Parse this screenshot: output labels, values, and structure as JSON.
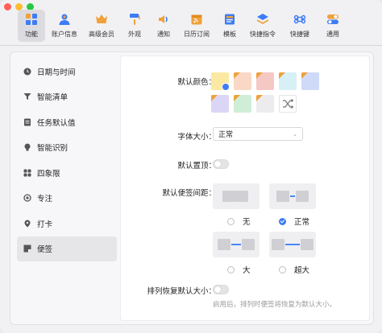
{
  "toolbar": {
    "items": [
      {
        "label": "功能",
        "icon": "functions-grid-icon",
        "color": "#3d7cf5",
        "active": true
      },
      {
        "label": "账户信息",
        "icon": "user-icon",
        "color": "#3d7cf5"
      },
      {
        "label": "高级会员",
        "icon": "crown-icon",
        "color": "#f0a13a"
      },
      {
        "label": "外观",
        "icon": "paint-roller-icon",
        "color": "#f0a13a"
      },
      {
        "label": "通知",
        "icon": "speaker-icon",
        "color": "#f0a13a"
      },
      {
        "label": "日历订阅",
        "icon": "calendar-feed-icon",
        "color": "#f0a13a"
      },
      {
        "label": "模板",
        "icon": "template-icon",
        "color": "#3d7cf5"
      },
      {
        "label": "快捷指令",
        "icon": "layers-icon",
        "color": "#3d7cf5"
      },
      {
        "label": "快捷键",
        "icon": "command-icon",
        "color": "#3d7cf5"
      },
      {
        "label": "通用",
        "icon": "toggle-icon",
        "color": "#3d7cf5"
      }
    ]
  },
  "sidebar": {
    "items": [
      {
        "label": "日期与时间",
        "icon": "clock-icon"
      },
      {
        "label": "智能清单",
        "icon": "filter-icon"
      },
      {
        "label": "任务默认值",
        "icon": "list-icon"
      },
      {
        "label": "智能识别",
        "icon": "bulb-icon"
      },
      {
        "label": "四象限",
        "icon": "quadrant-icon"
      },
      {
        "label": "专注",
        "icon": "focus-icon"
      },
      {
        "label": "打卡",
        "icon": "pin-icon"
      },
      {
        "label": "便签",
        "icon": "sticky-note-icon",
        "active": true
      }
    ]
  },
  "settings": {
    "default_color_label": "默认颜色：",
    "swatches": [
      {
        "color": "#fbe9a3",
        "corner": false,
        "selected": true
      },
      {
        "color": "#f9d9c6",
        "corner": true
      },
      {
        "color": "#f6c8c3",
        "corner": true
      },
      {
        "color": "#d7f0f6",
        "corner": true
      },
      {
        "color": "#cfdaf8",
        "corner": true
      },
      {
        "color": "#dcd6f6",
        "corner": true
      },
      {
        "color": "#cfeed7",
        "corner": true
      },
      {
        "color": "#ececee",
        "corner": true
      },
      {
        "color": "#ffffff",
        "corner": false,
        "shuffle": true
      }
    ],
    "font_size_label": "字体大小：",
    "font_size_value": "正常",
    "default_pin_label": "默认置顶：",
    "default_pin_on": false,
    "spacing_label": "默认便签间距：",
    "spacing_options": [
      {
        "label": "无",
        "selected": false
      },
      {
        "label": "正常",
        "selected": true
      },
      {
        "label": "大",
        "selected": false
      },
      {
        "label": "超大",
        "selected": false
      }
    ],
    "restore_size_label": "排列恢复默认大小：",
    "restore_size_on": false,
    "restore_size_hint": "启用后，排列时便签将恢复为默认大小。"
  }
}
